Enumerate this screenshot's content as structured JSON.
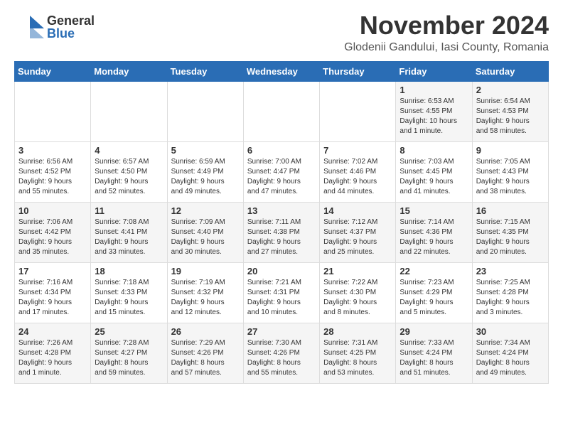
{
  "header": {
    "logo_general": "General",
    "logo_blue": "Blue",
    "month_year": "November 2024",
    "location": "Glodenii Gandului, Iasi County, Romania"
  },
  "days_of_week": [
    "Sunday",
    "Monday",
    "Tuesday",
    "Wednesday",
    "Thursday",
    "Friday",
    "Saturday"
  ],
  "weeks": [
    [
      {
        "day": "",
        "info": ""
      },
      {
        "day": "",
        "info": ""
      },
      {
        "day": "",
        "info": ""
      },
      {
        "day": "",
        "info": ""
      },
      {
        "day": "",
        "info": ""
      },
      {
        "day": "1",
        "info": "Sunrise: 6:53 AM\nSunset: 4:55 PM\nDaylight: 10 hours\nand 1 minute."
      },
      {
        "day": "2",
        "info": "Sunrise: 6:54 AM\nSunset: 4:53 PM\nDaylight: 9 hours\nand 58 minutes."
      }
    ],
    [
      {
        "day": "3",
        "info": "Sunrise: 6:56 AM\nSunset: 4:52 PM\nDaylight: 9 hours\nand 55 minutes."
      },
      {
        "day": "4",
        "info": "Sunrise: 6:57 AM\nSunset: 4:50 PM\nDaylight: 9 hours\nand 52 minutes."
      },
      {
        "day": "5",
        "info": "Sunrise: 6:59 AM\nSunset: 4:49 PM\nDaylight: 9 hours\nand 49 minutes."
      },
      {
        "day": "6",
        "info": "Sunrise: 7:00 AM\nSunset: 4:47 PM\nDaylight: 9 hours\nand 47 minutes."
      },
      {
        "day": "7",
        "info": "Sunrise: 7:02 AM\nSunset: 4:46 PM\nDaylight: 9 hours\nand 44 minutes."
      },
      {
        "day": "8",
        "info": "Sunrise: 7:03 AM\nSunset: 4:45 PM\nDaylight: 9 hours\nand 41 minutes."
      },
      {
        "day": "9",
        "info": "Sunrise: 7:05 AM\nSunset: 4:43 PM\nDaylight: 9 hours\nand 38 minutes."
      }
    ],
    [
      {
        "day": "10",
        "info": "Sunrise: 7:06 AM\nSunset: 4:42 PM\nDaylight: 9 hours\nand 35 minutes."
      },
      {
        "day": "11",
        "info": "Sunrise: 7:08 AM\nSunset: 4:41 PM\nDaylight: 9 hours\nand 33 minutes."
      },
      {
        "day": "12",
        "info": "Sunrise: 7:09 AM\nSunset: 4:40 PM\nDaylight: 9 hours\nand 30 minutes."
      },
      {
        "day": "13",
        "info": "Sunrise: 7:11 AM\nSunset: 4:38 PM\nDaylight: 9 hours\nand 27 minutes."
      },
      {
        "day": "14",
        "info": "Sunrise: 7:12 AM\nSunset: 4:37 PM\nDaylight: 9 hours\nand 25 minutes."
      },
      {
        "day": "15",
        "info": "Sunrise: 7:14 AM\nSunset: 4:36 PM\nDaylight: 9 hours\nand 22 minutes."
      },
      {
        "day": "16",
        "info": "Sunrise: 7:15 AM\nSunset: 4:35 PM\nDaylight: 9 hours\nand 20 minutes."
      }
    ],
    [
      {
        "day": "17",
        "info": "Sunrise: 7:16 AM\nSunset: 4:34 PM\nDaylight: 9 hours\nand 17 minutes."
      },
      {
        "day": "18",
        "info": "Sunrise: 7:18 AM\nSunset: 4:33 PM\nDaylight: 9 hours\nand 15 minutes."
      },
      {
        "day": "19",
        "info": "Sunrise: 7:19 AM\nSunset: 4:32 PM\nDaylight: 9 hours\nand 12 minutes."
      },
      {
        "day": "20",
        "info": "Sunrise: 7:21 AM\nSunset: 4:31 PM\nDaylight: 9 hours\nand 10 minutes."
      },
      {
        "day": "21",
        "info": "Sunrise: 7:22 AM\nSunset: 4:30 PM\nDaylight: 9 hours\nand 8 minutes."
      },
      {
        "day": "22",
        "info": "Sunrise: 7:23 AM\nSunset: 4:29 PM\nDaylight: 9 hours\nand 5 minutes."
      },
      {
        "day": "23",
        "info": "Sunrise: 7:25 AM\nSunset: 4:28 PM\nDaylight: 9 hours\nand 3 minutes."
      }
    ],
    [
      {
        "day": "24",
        "info": "Sunrise: 7:26 AM\nSunset: 4:28 PM\nDaylight: 9 hours\nand 1 minute."
      },
      {
        "day": "25",
        "info": "Sunrise: 7:28 AM\nSunset: 4:27 PM\nDaylight: 8 hours\nand 59 minutes."
      },
      {
        "day": "26",
        "info": "Sunrise: 7:29 AM\nSunset: 4:26 PM\nDaylight: 8 hours\nand 57 minutes."
      },
      {
        "day": "27",
        "info": "Sunrise: 7:30 AM\nSunset: 4:26 PM\nDaylight: 8 hours\nand 55 minutes."
      },
      {
        "day": "28",
        "info": "Sunrise: 7:31 AM\nSunset: 4:25 PM\nDaylight: 8 hours\nand 53 minutes."
      },
      {
        "day": "29",
        "info": "Sunrise: 7:33 AM\nSunset: 4:24 PM\nDaylight: 8 hours\nand 51 minutes."
      },
      {
        "day": "30",
        "info": "Sunrise: 7:34 AM\nSunset: 4:24 PM\nDaylight: 8 hours\nand 49 minutes."
      }
    ]
  ]
}
